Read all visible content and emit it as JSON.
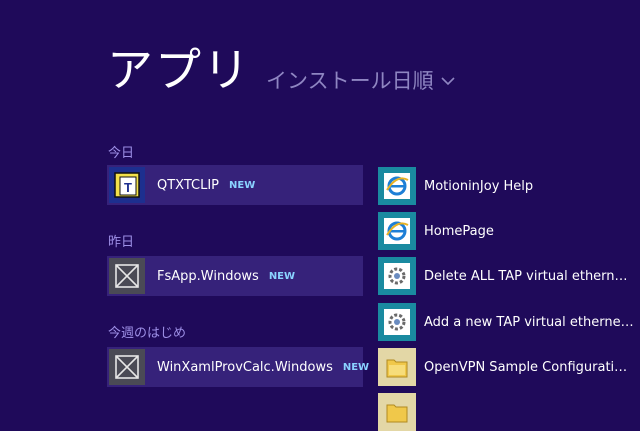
{
  "header": {
    "title": "アプリ",
    "sort_label": "インストール日順"
  },
  "groups": [
    {
      "label": "今日",
      "items": [
        {
          "name": "QTXTCLIP",
          "badge": "NEW",
          "icon": "qtxtclip-app-icon"
        }
      ]
    },
    {
      "label": "昨日",
      "items": [
        {
          "name": "FsApp.Windows",
          "badge": "NEW",
          "icon": "generic-app-icon"
        }
      ]
    },
    {
      "label": "今週のはじめ",
      "items": [
        {
          "name": "WinXamlProvCalc.Windows",
          "badge": "NEW",
          "icon": "generic-app-icon"
        }
      ]
    }
  ],
  "right_column": [
    {
      "name": "MotioninJoy Help",
      "icon": "internet-explorer-icon"
    },
    {
      "name": "HomePage",
      "icon": "internet-explorer-icon"
    },
    {
      "name": "Delete ALL TAP virtual ethernet…",
      "icon": "settings-gear-icon"
    },
    {
      "name": "Add a new TAP virtual ethernet…",
      "icon": "settings-gear-icon"
    },
    {
      "name": "OpenVPN Sample Configuratio…",
      "icon": "folder-icon"
    },
    {
      "name": "",
      "icon": "folder-icon"
    }
  ],
  "colors": {
    "background": "#1f0a5a",
    "tile": "#36227a",
    "group_label": "#9d8fe6",
    "badge": "#8ad2ff"
  }
}
